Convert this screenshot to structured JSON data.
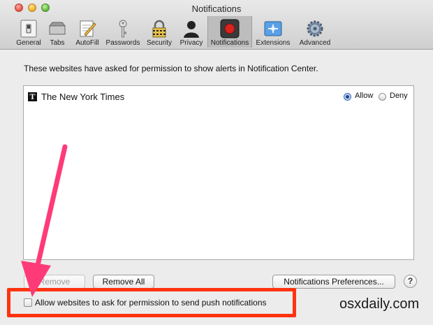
{
  "window": {
    "title": "Notifications"
  },
  "toolbar": {
    "items": [
      {
        "label": "General",
        "icon": "general-switch-icon"
      },
      {
        "label": "Tabs",
        "icon": "tabs-icon"
      },
      {
        "label": "AutoFill",
        "icon": "autofill-pencil-icon"
      },
      {
        "label": "Passwords",
        "icon": "key-icon"
      },
      {
        "label": "Security",
        "icon": "padlock-icon"
      },
      {
        "label": "Privacy",
        "icon": "person-silhouette-icon"
      },
      {
        "label": "Notifications",
        "icon": "notification-record-icon",
        "selected": true
      },
      {
        "label": "Extensions",
        "icon": "puzzle-extensions-icon"
      },
      {
        "label": "Advanced",
        "icon": "gear-icon"
      }
    ]
  },
  "content": {
    "description": "These websites have asked for permission to show alerts in Notification Center.",
    "sites": [
      {
        "name": "The New York Times",
        "favicon_glyph": "T",
        "permission": "Allow"
      }
    ],
    "allow_label": "Allow",
    "deny_label": "Deny",
    "remove_label": "Remove",
    "remove_all_label": "Remove All",
    "prefs_label": "Notifications Preferences...",
    "help_label": "?",
    "push_checkbox_label": "Allow websites to ask for permission to send push notifications",
    "push_checkbox_checked": false
  },
  "watermark": "osxdaily.com",
  "colors": {
    "highlight_box": "#ff3311",
    "arrow": "#ff3a78",
    "selected_radio": "#3b6fb6"
  }
}
